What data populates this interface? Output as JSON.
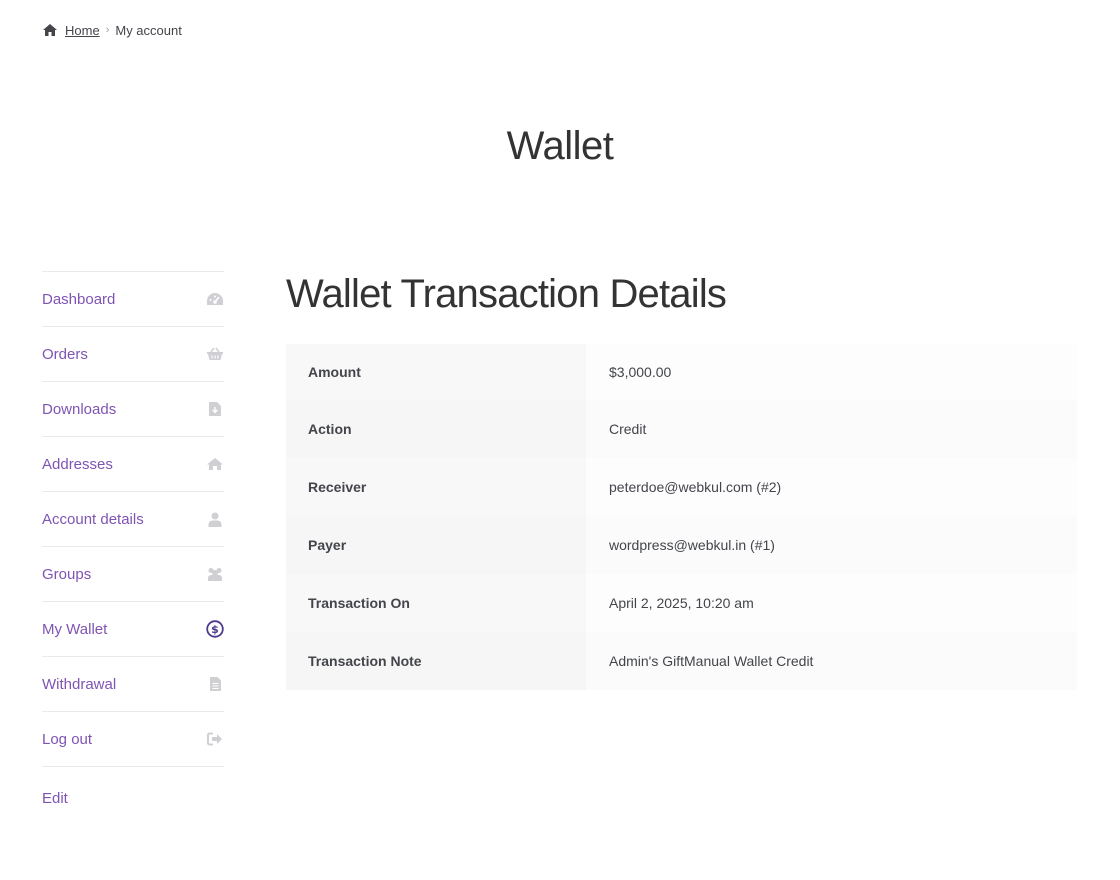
{
  "breadcrumb": {
    "home": "Home",
    "current": "My account"
  },
  "page_title": "Wallet",
  "sidebar": {
    "items": [
      {
        "label": "Dashboard",
        "icon": "dashboard-icon"
      },
      {
        "label": "Orders",
        "icon": "basket-icon"
      },
      {
        "label": "Downloads",
        "icon": "file-download-icon"
      },
      {
        "label": "Addresses",
        "icon": "home-icon"
      },
      {
        "label": "Account details",
        "icon": "user-icon"
      },
      {
        "label": "Groups",
        "icon": "group-icon"
      },
      {
        "label": "My Wallet",
        "icon": "dollar-circle-icon"
      },
      {
        "label": "Withdrawal",
        "icon": "document-icon"
      },
      {
        "label": "Log out",
        "icon": "sign-out-icon"
      }
    ],
    "edit": "Edit"
  },
  "main": {
    "title": "Wallet Transaction Details",
    "rows": [
      {
        "label": "Amount",
        "value": "$3,000.00"
      },
      {
        "label": "Action",
        "value": "Credit"
      },
      {
        "label": "Receiver",
        "value": "peterdoe@webkul.com (#2)"
      },
      {
        "label": "Payer",
        "value": "wordpress@webkul.in (#1)"
      },
      {
        "label": "Transaction On",
        "value": "April 2, 2025, 10:20 am"
      },
      {
        "label": "Transaction Note",
        "value": "Admin's GiftManual Wallet Credit"
      }
    ]
  },
  "colors": {
    "accent": "#7f54b3",
    "icon_muted": "#d0d0d4",
    "text": "#43454b"
  }
}
